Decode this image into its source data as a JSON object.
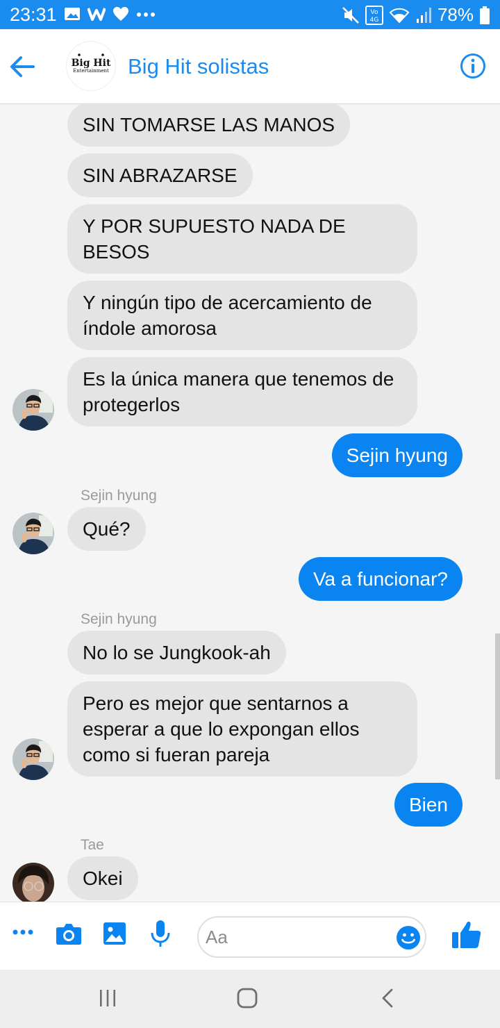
{
  "status_bar": {
    "time": "23:31",
    "battery_percent": "78%",
    "left_icons": [
      "gallery-icon",
      "w-app-icon",
      "heart-icon",
      "more-dots-icon"
    ],
    "right_icons": [
      "mute-icon",
      "volte-4g-icon",
      "wifi-icon",
      "signal-icon",
      "battery-icon"
    ]
  },
  "header": {
    "title": "Big Hit solistas",
    "avatar_logo": "Big Hit",
    "avatar_logo_sub": "Entertainment"
  },
  "messages": [
    {
      "direction": "in",
      "text": "SIN TOMARSE LAS MANOS"
    },
    {
      "direction": "in",
      "text": "SIN ABRAZARSE"
    },
    {
      "direction": "in",
      "text": "Y POR SUPUESTO NADA DE BESOS"
    },
    {
      "direction": "in",
      "text": "Y ningún tipo de acercamiento de índole amorosa"
    },
    {
      "direction": "in",
      "text": "Es la única manera que tenemos de protegerlos",
      "avatar": "sejin"
    },
    {
      "direction": "out",
      "text": "Sejin hyung"
    },
    {
      "direction": "in",
      "sender": "Sejin hyung",
      "text": "Qué?",
      "avatar": "sejin"
    },
    {
      "direction": "out",
      "text": "Va a funcionar?"
    },
    {
      "direction": "in",
      "sender": "Sejin hyung",
      "text": "No lo se Jungkook-ah"
    },
    {
      "direction": "in",
      "text": "Pero es mejor que sentarnos a esperar a que lo expongan ellos como si fueran pareja",
      "avatar": "sejin"
    },
    {
      "direction": "out",
      "text": "Bien"
    },
    {
      "direction": "in",
      "sender": "Tae",
      "text": "Okei",
      "avatar": "tae"
    }
  ],
  "composer": {
    "placeholder": "Aa",
    "icons": [
      "more-icon",
      "camera-icon",
      "image-icon",
      "microphone-icon",
      "emoji-icon",
      "thumbs-up-icon"
    ]
  },
  "nav_bar": {
    "icons": [
      "recent-apps-icon",
      "home-icon",
      "back-icon"
    ]
  },
  "colors": {
    "status_bar": "#1a8cf0",
    "accent": "#0a84f0",
    "incoming_bubble": "#e4e4e4",
    "background": "#f5f5f5"
  }
}
